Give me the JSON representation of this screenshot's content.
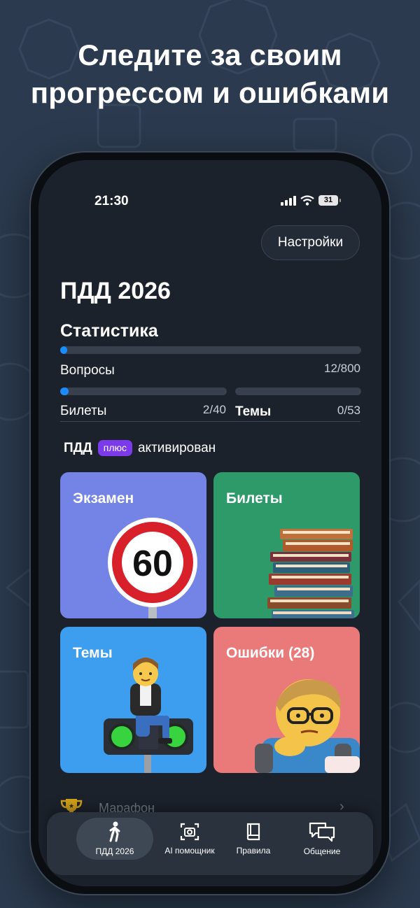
{
  "headline": {
    "line1": "Следите за своим",
    "line2": "прогрессом и ошибками"
  },
  "status_bar": {
    "time": "21:30",
    "battery": "31"
  },
  "header": {
    "settings_label": "Настройки",
    "app_title": "ПДД 2026"
  },
  "statistics": {
    "title": "Статистика",
    "questions": {
      "label": "Вопросы",
      "value": "12/800",
      "progress": 0.015
    },
    "tickets": {
      "label": "Билеты",
      "value": "2/40",
      "progress": 0.05
    },
    "topics": {
      "label": "Темы",
      "value": "0/53",
      "progress": 0.0
    }
  },
  "subscription": {
    "prefix": "ПДД",
    "badge": "плюс",
    "status": "активирован"
  },
  "cards": [
    {
      "title": "Экзамен",
      "color": "#7384e6",
      "icon": "speed-limit-60-sign",
      "sign_text": "60"
    },
    {
      "title": "Билеты",
      "color": "#2e9a6a",
      "icon": "book-stack"
    },
    {
      "title": "Темы",
      "color": "#3d9ef0",
      "icon": "person-on-traffic-light"
    },
    {
      "title": "Ошибки (28)",
      "color": "#ea7a7a",
      "icon": "studying-person"
    }
  ],
  "marathon": {
    "label": "Марафон"
  },
  "tabbar": {
    "items": [
      {
        "label": "ПДД 2026",
        "icon": "walking-person-icon",
        "active": true
      },
      {
        "label": "AI помощник",
        "icon": "camera-scan-icon",
        "active": false
      },
      {
        "label": "Правила",
        "icon": "book-icon",
        "active": false
      },
      {
        "label": "Общение",
        "icon": "chat-bubbles-icon",
        "active": false
      }
    ]
  },
  "colors": {
    "background": "#2b3a4e",
    "screen": "#1c222c",
    "accent": "#1a8cff",
    "badge": "#7c3aed"
  }
}
